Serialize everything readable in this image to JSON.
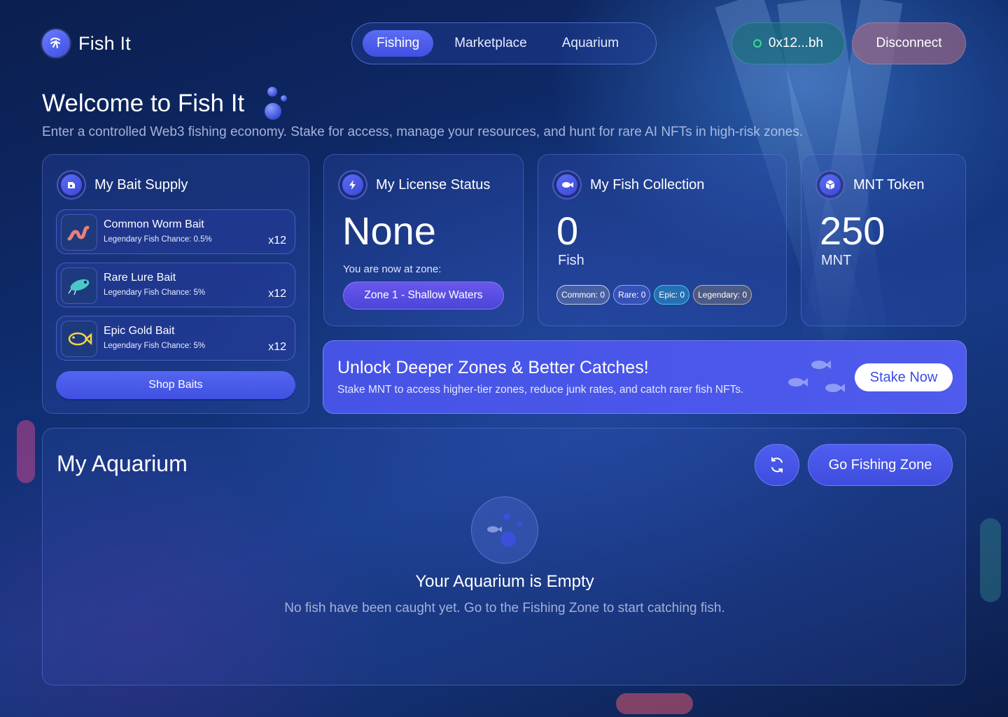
{
  "app": {
    "name": "Fish It"
  },
  "nav": {
    "tabs": [
      {
        "label": "Fishing",
        "active": true
      },
      {
        "label": "Marketplace",
        "active": false
      },
      {
        "label": "Aquarium",
        "active": false
      }
    ]
  },
  "wallet": {
    "address": "0x12...bh",
    "status_color": "#35e08a"
  },
  "disconnect_label": "Disconnect",
  "hero": {
    "title": "Welcome to Fish It",
    "subtitle": "Enter a controlled Web3 fishing economy. Stake for access, manage your resources, and hunt for rare AI NFTs in high-risk zones."
  },
  "bait_supply": {
    "title": "My Bait Supply",
    "icon": "bait-icon",
    "items": [
      {
        "name": "Common Worm Bait",
        "chance": "Legendary Fish Chance: 0.5%",
        "qty": "x12",
        "icon": "worm-icon"
      },
      {
        "name": "Rare Lure Bait",
        "chance": "Legendary Fish Chance: 5%",
        "qty": "x12",
        "icon": "lure-icon"
      },
      {
        "name": "Epic Gold Bait",
        "chance": "Legendary Fish Chance: 5%",
        "qty": "x12",
        "icon": "gold-fish-icon"
      }
    ],
    "shop_label": "Shop Baits"
  },
  "license": {
    "title": "My License Status",
    "icon": "lightning-icon",
    "value": "None",
    "zone_label": "You are now at zone:",
    "zone": "Zone 1 - Shallow Waters"
  },
  "collection": {
    "title": "My Fish Collection",
    "icon": "fish-icon",
    "value": "0",
    "unit": "Fish",
    "rarities": [
      {
        "label": "Common: 0",
        "color": "#c9d1e6"
      },
      {
        "label": "Rare: 0",
        "color": "#8fa4ff"
      },
      {
        "label": "Epic: 0",
        "color": "#49c6e8"
      },
      {
        "label": "Legendary: 0",
        "color": "#b9b0a4"
      }
    ]
  },
  "token": {
    "title": "MNT Token",
    "icon": "cube-icon",
    "value": "250",
    "unit": "MNT"
  },
  "promo": {
    "title": "Unlock Deeper Zones & Better Catches!",
    "subtitle": "Stake MNT to access higher-tier zones, reduce junk rates, and catch rarer fish NFTs.",
    "button": "Stake Now"
  },
  "aquarium": {
    "title": "My Aquarium",
    "go_label": "Go Fishing Zone",
    "empty_title": "Your Aquarium is Empty",
    "empty_sub": "No fish have been caught yet. Go to the Fishing Zone to start catching fish."
  },
  "colors": {
    "accent": "#4a58e8",
    "background": "#0f2c6e"
  }
}
